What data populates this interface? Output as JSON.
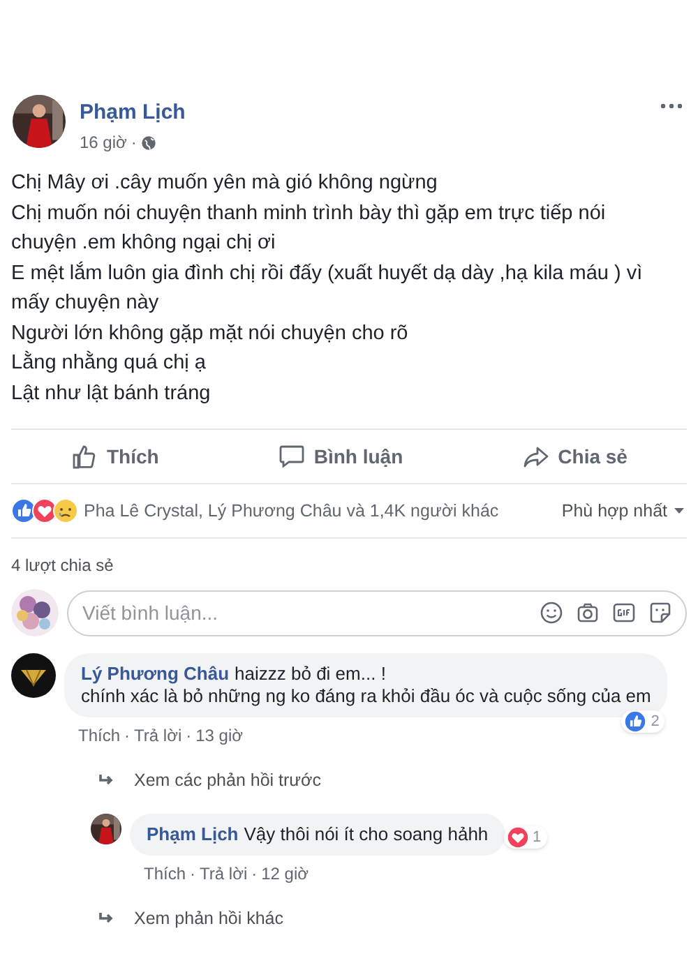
{
  "post": {
    "author": "Phạm Lịch",
    "time": "16 giờ",
    "separator": "·",
    "lines": [
      "Chị Mây ơi .cây muốn yên mà gió không ngừng",
      "Chị muốn nói chuyện thanh minh trình bày thì gặp em trực tiếp nói chuyện .em không ngại chị ơi",
      "E mệt lắm luôn gia đình chị rồi đấy (xuất huyết dạ dày ,hạ kila máu ) vì mấy chuyện này",
      "Người lớn không gặp mặt nói chuyện cho rõ",
      "Lằng nhằng quá chị ạ",
      "Lật như lật bánh tráng"
    ]
  },
  "actions": [
    {
      "kind": "like",
      "label": "Thích"
    },
    {
      "kind": "comment",
      "label": "Bình luận"
    },
    {
      "kind": "share",
      "label": "Chia sẻ"
    }
  ],
  "reactions": {
    "icons": [
      {
        "kind": "like"
      },
      {
        "kind": "love"
      },
      {
        "kind": "sad"
      }
    ],
    "summary": "Pha Lê Crystal, Lý Phương Châu và 1,4K người khác",
    "sort": "Phù hợp nhất"
  },
  "shares": "4 lượt chia sẻ",
  "composer": {
    "placeholder": "Viết bình luận..."
  },
  "comments": [
    {
      "author": "Lý Phương Châu",
      "avatar": {
        "kind": "logo"
      },
      "reply": false,
      "text": "haizzz bỏ đi em... !\nchính xác là bỏ những ng ko đáng ra khỏi đầu óc và cuộc sống của em",
      "reaction": {
        "kind": "like",
        "count": "2"
      },
      "separator": "·",
      "like": "Thích",
      "answer": "Trả lời",
      "time": "13 giờ"
    },
    {
      "kind": "more",
      "label": "Xem các phản hồi trước"
    },
    {
      "author": "Phạm Lịch",
      "reply": true,
      "text": "Vậy thôi nói ít cho soang hảhh",
      "reaction": {
        "kind": "love",
        "count": "1"
      },
      "separator": "·",
      "like": "Thích",
      "answer": "Trả lời",
      "time": "12 giờ"
    },
    {
      "kind": "more",
      "label": "Xem phản hồi khác"
    }
  ]
}
